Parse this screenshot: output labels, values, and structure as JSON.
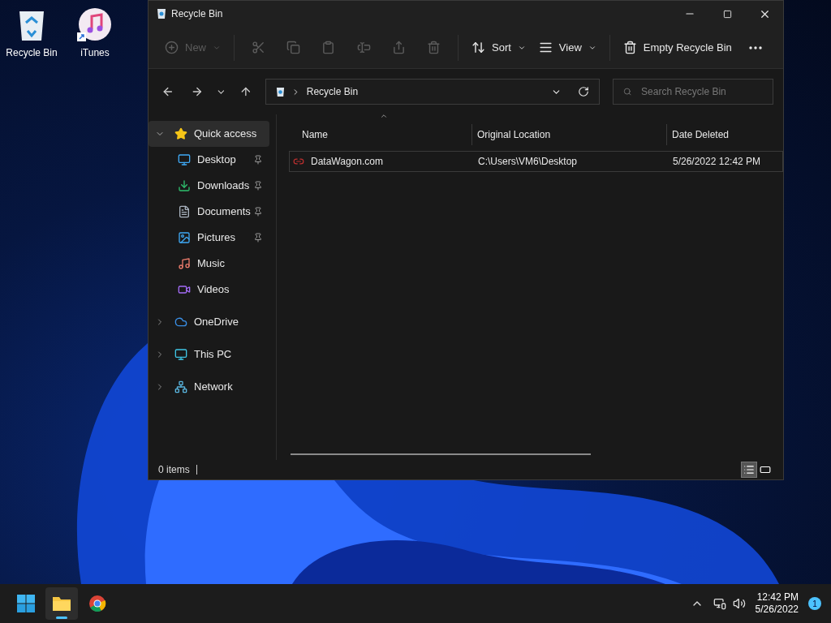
{
  "desktop_icons": [
    {
      "kind": "recycle",
      "label": "Recycle Bin"
    },
    {
      "kind": "music",
      "label": "iTunes"
    }
  ],
  "window": {
    "title": "Recycle Bin"
  },
  "toolbar": [
    {
      "kind": "new",
      "label": "New",
      "disabled": true
    },
    {
      "kind": "cut",
      "disabled": true
    },
    {
      "kind": "copy",
      "disabled": true
    },
    {
      "kind": "paste",
      "disabled": true
    },
    {
      "kind": "rename",
      "disabled": true
    },
    {
      "kind": "share",
      "disabled": true
    },
    {
      "kind": "delete",
      "disabled": true
    },
    {
      "kind": "sort",
      "label": "Sort",
      "disabled": false
    },
    {
      "kind": "view",
      "label": "View",
      "disabled": false
    },
    {
      "kind": "empty",
      "label": "Empty Recycle Bin",
      "disabled": false
    },
    {
      "kind": "more",
      "disabled": false
    }
  ],
  "address": {
    "path": "Recycle Bin"
  },
  "search": {
    "placeholder": "Search Recycle Bin"
  },
  "sidebar": {
    "items": [
      {
        "kind": "star",
        "label": "Quick access",
        "expanded": true,
        "selected": true,
        "children": [
          {
            "kind": "desktop",
            "label": "Desktop",
            "pinned": true,
            "selected": false
          },
          {
            "kind": "download",
            "label": "Downloads",
            "pinned": true,
            "selected": false
          },
          {
            "kind": "document",
            "label": "Documents",
            "pinned": true,
            "selected": false
          },
          {
            "kind": "picture",
            "label": "Pictures",
            "pinned": true,
            "selected": false
          },
          {
            "kind": "music",
            "label": "Music",
            "pinned": false,
            "selected": false
          },
          {
            "kind": "video",
            "label": "Videos",
            "pinned": false,
            "selected": false
          }
        ]
      },
      {
        "kind": "cloud",
        "label": "OneDrive",
        "expanded": false,
        "selected": false
      },
      {
        "kind": "pc",
        "label": "This PC",
        "expanded": false,
        "selected": false
      },
      {
        "kind": "network",
        "label": "Network",
        "expanded": false,
        "selected": false
      }
    ]
  },
  "table": {
    "columns": [
      "Name",
      "Original Location",
      "Date Deleted"
    ],
    "rows": [
      {
        "cells": [
          "DataWagon.com",
          "C:\\Users\\VM6\\Desktop",
          "5/26/2022 12:42 PM"
        ]
      }
    ]
  },
  "status_bar": {
    "count": "0 items",
    "views": [
      {
        "kind": "details",
        "selected": true
      },
      {
        "kind": "tiles",
        "selected": false
      }
    ]
  },
  "taskbar": {
    "apps": [
      {
        "kind": "start",
        "active": false
      },
      {
        "kind": "explorer",
        "active": true
      },
      {
        "kind": "chrome",
        "active": false
      }
    ],
    "time": "12:42 PM",
    "date": "5/26/2022",
    "notifications": "1"
  }
}
